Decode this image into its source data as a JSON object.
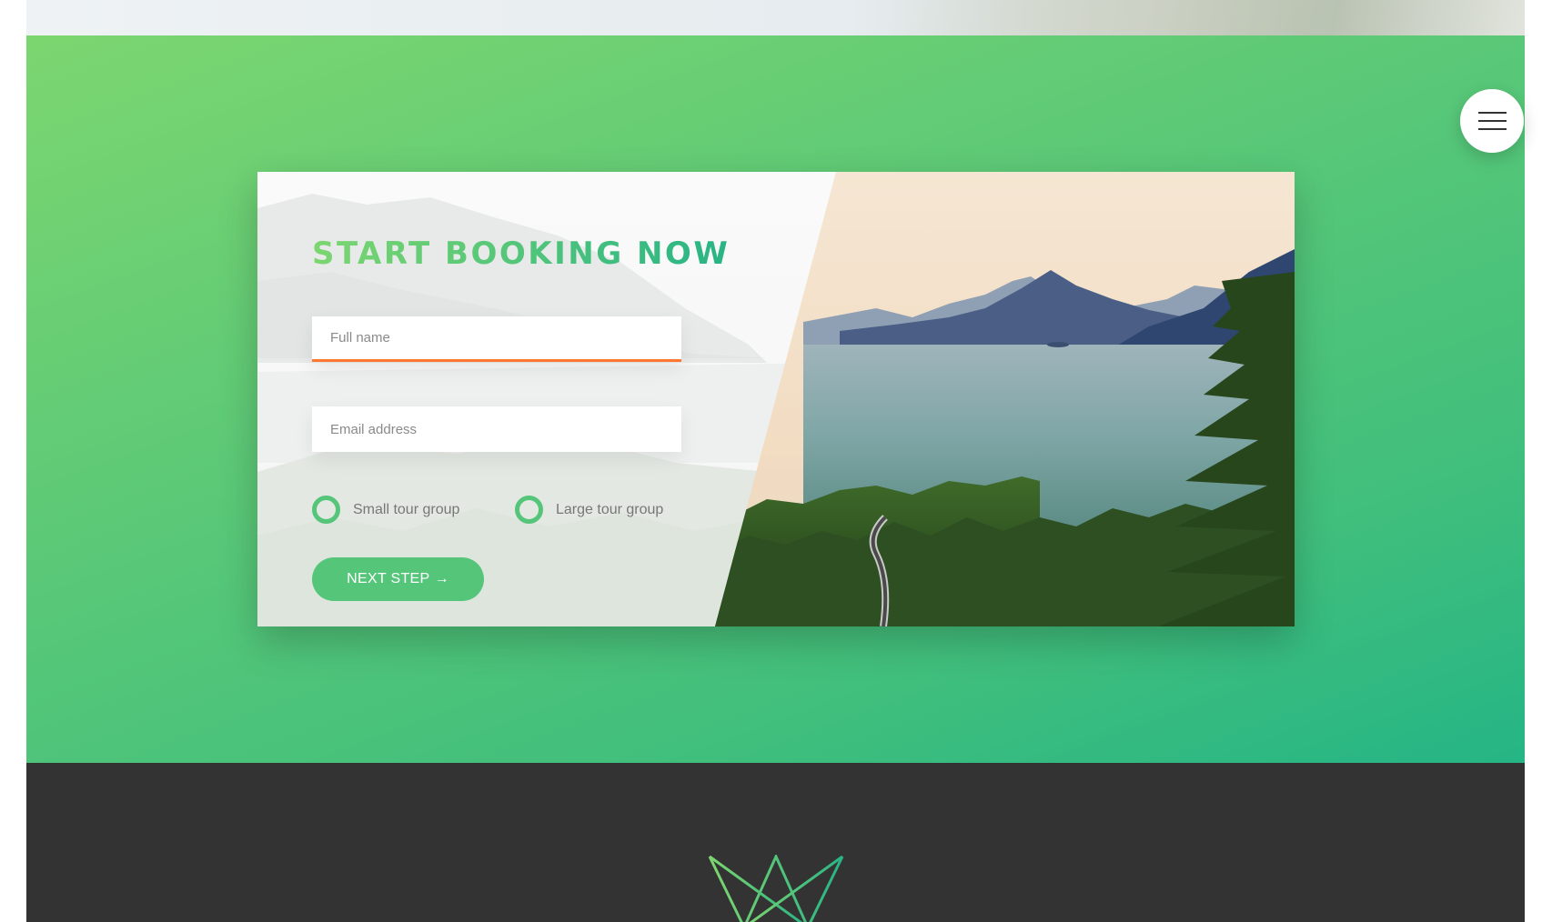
{
  "menu": {
    "icon": "hamburger-icon"
  },
  "booking": {
    "heading": "START BOOKING NOW",
    "name_placeholder": "Full name",
    "email_placeholder": "Email address",
    "radio_options": [
      "Small tour group",
      "Large tour group"
    ],
    "next_label": "NEXT STEP",
    "next_arrow": "→"
  },
  "colors": {
    "primary": "#55c57a",
    "primary_light": "#7ed56f",
    "primary_dark": "#28b485",
    "focus_underline": "#ff7730",
    "footer": "#333333"
  },
  "footer": {
    "logo_icon": "crown-logo-icon"
  }
}
